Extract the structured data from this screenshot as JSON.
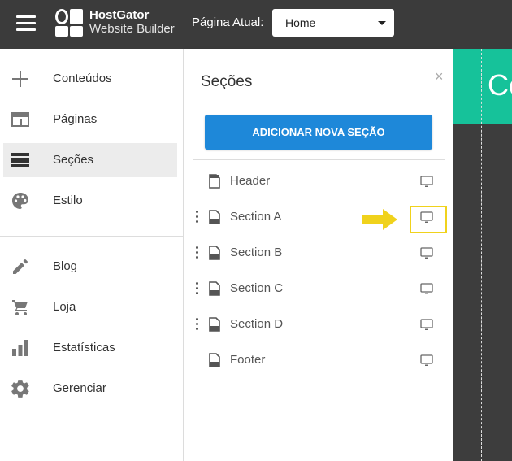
{
  "topbar": {
    "logo_line1": "HostGator",
    "logo_line2": "Website Builder",
    "current_page_label": "Página Atual:",
    "current_page_value": "Home"
  },
  "sidebar": {
    "items": [
      {
        "label": "Conteúdos",
        "icon": "plus-icon"
      },
      {
        "label": "Páginas",
        "icon": "pages-icon"
      },
      {
        "label": "Seções",
        "icon": "sections-icon",
        "active": true
      },
      {
        "label": "Estilo",
        "icon": "palette-icon"
      },
      {
        "label": "Blog",
        "icon": "pencil-icon"
      },
      {
        "label": "Loja",
        "icon": "cart-icon"
      },
      {
        "label": "Estatísticas",
        "icon": "bar-chart-icon"
      },
      {
        "label": "Gerenciar",
        "icon": "gear-icon"
      }
    ]
  },
  "sections_panel": {
    "title": "Seções",
    "close": "×",
    "add_button": "ADICIONAR NOVA SEÇÃO",
    "sections": [
      {
        "name": "Header",
        "draggable": false
      },
      {
        "name": "Section A",
        "draggable": true
      },
      {
        "name": "Section B",
        "draggable": true
      },
      {
        "name": "Section C",
        "draggable": true
      },
      {
        "name": "Section D",
        "draggable": true
      },
      {
        "name": "Footer",
        "draggable": false
      }
    ]
  },
  "canvas": {
    "hero_text": "Co"
  },
  "colors": {
    "topbar": "#3b3b3b",
    "accent_button": "#1e88d9",
    "highlight": "#f0d21c",
    "hero": "#16c29a"
  }
}
